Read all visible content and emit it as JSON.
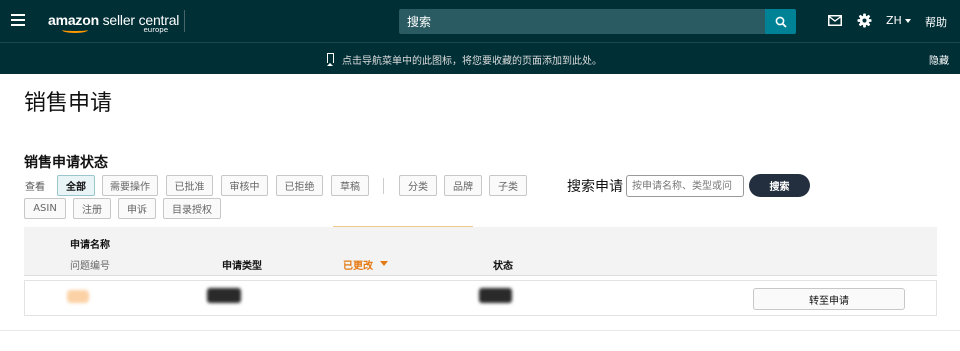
{
  "nav": {
    "logo_brand": "amazon",
    "logo_product": " seller central",
    "logo_region": "europe",
    "search_placeholder": "搜索",
    "language": "ZH",
    "help": "帮助"
  },
  "bookmark_bar": {
    "text": "点击导航菜单中的此图标，将您要收藏的页面添加到此处。",
    "hide": "隐藏"
  },
  "page": {
    "title": "销售申请"
  },
  "status_section": {
    "title": "销售申请状态",
    "view_label": "查看",
    "status_filters": [
      {
        "label": "全部",
        "active": true
      },
      {
        "label": "需要操作",
        "active": false
      },
      {
        "label": "已批准",
        "active": false
      },
      {
        "label": "审核中",
        "active": false
      },
      {
        "label": "已拒绝",
        "active": false
      },
      {
        "label": "草稿",
        "active": false
      }
    ],
    "category_filters": [
      {
        "label": "分类"
      },
      {
        "label": "品牌"
      },
      {
        "label": "子类"
      },
      {
        "label": "ASIN"
      },
      {
        "label": "注册"
      },
      {
        "label": "申诉"
      },
      {
        "label": "目录授权"
      }
    ]
  },
  "search_apps": {
    "label": "搜索申请",
    "placeholder": "按申请名称、类型或问",
    "button": "搜索"
  },
  "table": {
    "headers": {
      "name": "申请名称",
      "issue_id": "问题编号",
      "type": "申请类型",
      "updated": "已更改",
      "status": "状态"
    },
    "rows": [
      {
        "action": "转至申请"
      }
    ]
  },
  "colors": {
    "nav_bg": "#002f36",
    "search_btn": "#008296",
    "accent_orange": "#e47911",
    "primary_btn": "#232f3e"
  }
}
